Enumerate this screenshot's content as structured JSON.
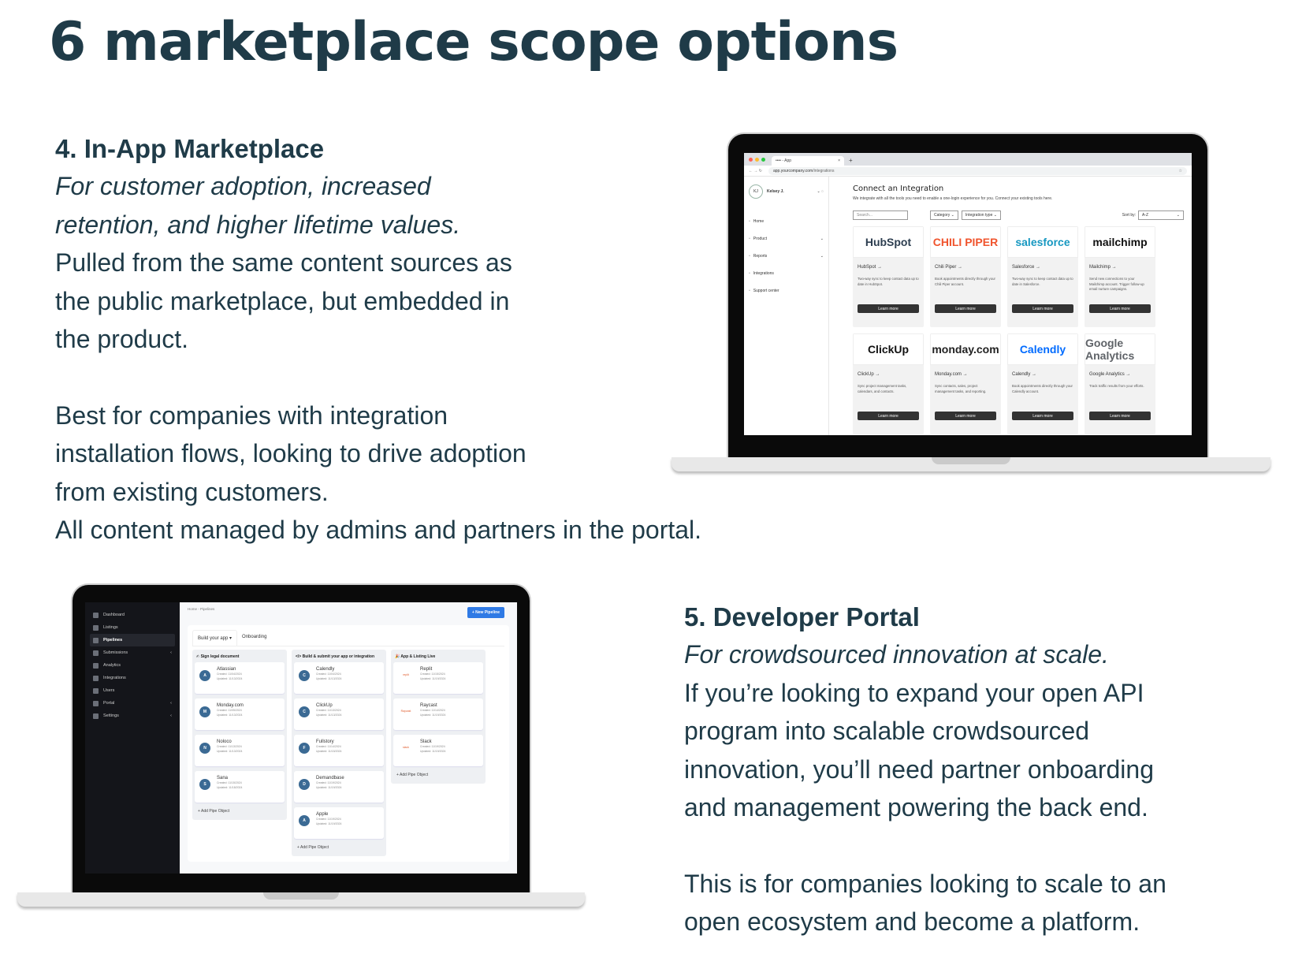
{
  "title": "6 marketplace scope options",
  "section4": {
    "heading": "4. In-App Marketplace",
    "tagline": [
      "For customer adoption, increased",
      "retention, and higher lifetime values."
    ],
    "body1": [
      "Pulled from the same content sources as",
      "the public marketplace, but embedded in",
      "the product."
    ],
    "body2": [
      "Best for companies with integration",
      "installation flows, looking to drive adoption",
      "from existing customers.",
      "All content managed by admins and partners in the portal."
    ]
  },
  "section5": {
    "heading": "5. Developer Portal",
    "tagline": "For crowdsourced innovation at scale.",
    "body1": [
      "If you’re looking to expand your open API",
      "program into scalable crowdsourced",
      "innovation, you’ll need partner onboarding",
      "and management powering the back end."
    ],
    "body2": [
      "This is for companies looking to scale to an",
      "open ecosystem and become a platform."
    ]
  },
  "inapp": {
    "tab_title": "•••• - App",
    "url_host": "app.yourcompany.com",
    "url_path": "/integrations",
    "user_initials": "KJ",
    "user_name": "Kelsey J.",
    "nav": [
      {
        "label": "Home",
        "chevron": false
      },
      {
        "label": "Product",
        "chevron": true
      },
      {
        "label": "Reports",
        "chevron": true
      },
      {
        "label": "Integrations",
        "chevron": false
      },
      {
        "label": "Support center",
        "chevron": false
      }
    ],
    "heading": "Connect an Integration",
    "subheading": "We integrate with all the tools you need to enable a one-login experience for you. Connect your existing tools here.",
    "search_placeholder": "Search...",
    "filter_category": "Category",
    "filter_type": "Integration type",
    "sort_label": "Sort by:",
    "sort_value": "A-Z",
    "learn_more": "Learn more",
    "cards": [
      {
        "logo": "HubSpot",
        "logo_color": "#2d3e50",
        "name": "HubSpot",
        "desc": "Two-way sync to keep contact data up to date in HubSpot."
      },
      {
        "logo": "CHILI PIPER",
        "logo_color": "#f0542d",
        "name": "Chili Piper",
        "desc": "Book appointments directly through your Chili Piper account."
      },
      {
        "logo": "salesforce",
        "logo_color": "#1798c1",
        "name": "Salesforce",
        "desc": "Two-way sync to keep contact data up to date in Salesforce."
      },
      {
        "logo": "mailchimp",
        "logo_color": "#111111",
        "name": "Mailchimp",
        "desc": "Send new connections to your Mailchimp account. Trigger follow-up email nurture campaigns."
      },
      {
        "logo": "ClickUp",
        "logo_color": "#111111",
        "name": "ClickUp",
        "desc": "Sync project management tasks, calendars, and contacts."
      },
      {
        "logo": "monday.com",
        "logo_color": "#222222",
        "name": "Monday.com",
        "desc": "Sync contacts, sales, project management tasks, and reporting."
      },
      {
        "logo": "Calendly",
        "logo_color": "#006bff",
        "name": "Calendly",
        "desc": "Book appointments directly through your Calendly account."
      },
      {
        "logo": "Google Analytics",
        "logo_color": "#5f6368",
        "name": "Google Analytics",
        "desc": "Track traffic results from your efforts."
      }
    ]
  },
  "portal": {
    "nav": [
      {
        "label": "Dashboard",
        "active": false,
        "chevron": false
      },
      {
        "label": "Listings",
        "active": false,
        "chevron": false
      },
      {
        "label": "Pipelines",
        "active": true,
        "chevron": false
      },
      {
        "label": "Submissions",
        "active": false,
        "chevron": true
      },
      {
        "label": "Analytics",
        "active": false,
        "chevron": false
      },
      {
        "label": "Integrations",
        "active": false,
        "chevron": false
      },
      {
        "label": "Users",
        "active": false,
        "chevron": false
      },
      {
        "label": "Portal",
        "active": false,
        "chevron": true
      },
      {
        "label": "Settings",
        "active": false,
        "chevron": true
      }
    ],
    "breadcrumb": "Home - Pipelines",
    "new_button": "+ New Pipeline",
    "tabs": [
      "Build your app ▾",
      "Onboarding"
    ],
    "add_label": "Add Pipe Object",
    "columns": [
      {
        "title": "✍ Sign legal document",
        "items": [
          {
            "initial": "A",
            "name": "Atlassian",
            "created": "Created: 11/04/2024",
            "updated": "Updated: 11/13/2024"
          },
          {
            "initial": "M",
            "name": "Monday.com",
            "created": "Created: 11/05/2024",
            "updated": "Updated: 11/13/2024"
          },
          {
            "initial": "N",
            "name": "Noloco",
            "created": "Created: 11/13/2024",
            "updated": "Updated: 11/13/2024"
          },
          {
            "initial": "S",
            "name": "Sana",
            "created": "Created: 11/15/2024",
            "updated": "Updated: 11/18/2024"
          }
        ]
      },
      {
        "title": "</> Build & submit your app or integration",
        "items": [
          {
            "initial": "C",
            "name": "Calendly",
            "created": "Created: 11/04/2024",
            "updated": "Updated: 11/13/2024"
          },
          {
            "initial": "C",
            "name": "ClickUp",
            "created": "Created: 11/13/2024",
            "updated": "Updated: 11/13/2024"
          },
          {
            "initial": "F",
            "name": "Fullstory",
            "created": "Created: 11/14/2024",
            "updated": "Updated: 11/15/2024"
          },
          {
            "initial": "D",
            "name": "Demandbase",
            "created": "Created: 11/19/2024",
            "updated": "Updated: 11/19/2024"
          },
          {
            "initial": "A",
            "name": "Apple",
            "created": "Created: 11/19/2024",
            "updated": "Updated: 11/19/2024"
          }
        ]
      },
      {
        "title": "🎉 App & Listing Live",
        "items": [
          {
            "logo": "replit",
            "name": "Replit",
            "created": "Created: 11/15/2024",
            "updated": "Updated: 11/19/2024"
          },
          {
            "logo": "Raycast",
            "name": "Raycast",
            "created": "Created: 11/14/2024",
            "updated": "Updated: 11/19/2024"
          },
          {
            "logo": "slack",
            "name": "Slack",
            "created": "Created: 11/19/2024",
            "updated": "Updated: 11/19/2024"
          }
        ]
      }
    ]
  }
}
